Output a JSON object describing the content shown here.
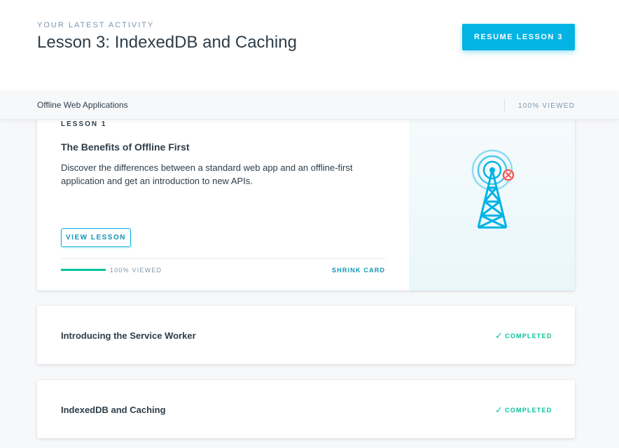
{
  "header": {
    "eyebrow": "YOUR LATEST ACTIVITY",
    "title": "Lesson 3: IndexedDB and Caching",
    "resume_label": "RESUME LESSON 3"
  },
  "subbar": {
    "course": "Offline Web Applications",
    "viewed": "100% VIEWED"
  },
  "lesson_card": {
    "number": "LESSON 1",
    "title": "The Benefits of Offline First",
    "description": "Discover the differences between a standard web app and an offline-first application and get an introduction to new APIs.",
    "view_label": "VIEW LESSON",
    "progress_percent": 100,
    "progress_label": "100% VIEWED",
    "shrink_label": "SHRINK CARD",
    "illustration_icon": "radio-tower-offline-icon"
  },
  "lesson_rows": [
    {
      "title": "Introducing the Service Worker",
      "status": "COMPLETED"
    },
    {
      "title": "IndexedDB and Caching",
      "status": "COMPLETED"
    }
  ],
  "colors": {
    "accent": "#02b3e4",
    "accent_dark": "#0f94b8",
    "success": "#02c39a",
    "text": "#2e3d49",
    "muted": "#7d97ad",
    "error": "#f15b5b"
  }
}
